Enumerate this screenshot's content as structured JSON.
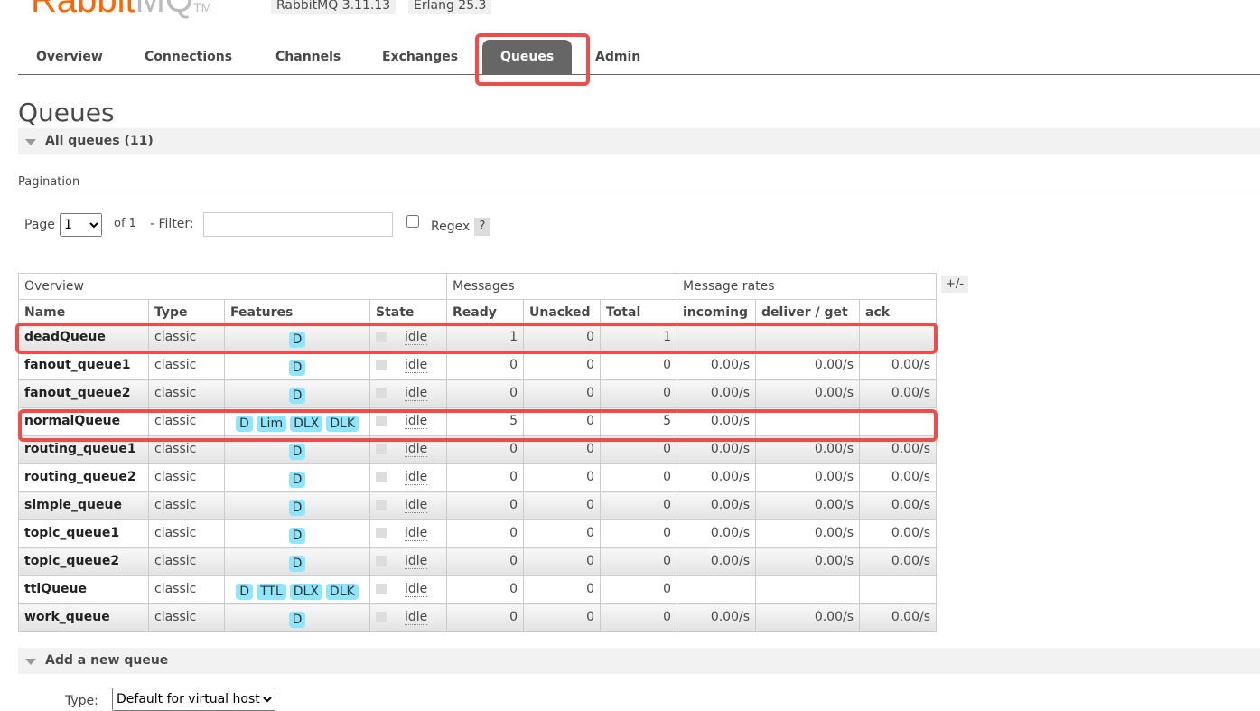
{
  "header": {
    "logo": "RabbitMQ",
    "versions": [
      "RabbitMQ 3.11.13",
      "Erlang 25.3"
    ]
  },
  "nav": [
    "Overview",
    "Connections",
    "Channels",
    "Exchanges",
    "Queues",
    "Admin"
  ],
  "active_tab": "Queues",
  "page_title": "Queues",
  "all_queues": "All queues (11)",
  "pagination": {
    "label": "Pagination",
    "page_label": "Page",
    "page_value": "1",
    "of": "of 1",
    "filter_label": "- Filter:",
    "filter_value": "",
    "regex_label": "Regex",
    "help": "?"
  },
  "table": {
    "groups": [
      "Overview",
      "Messages",
      "Message rates"
    ],
    "columns": [
      "Name",
      "Type",
      "Features",
      "State",
      "Ready",
      "Unacked",
      "Total",
      "incoming",
      "deliver / get",
      "ack"
    ],
    "plus_minus": "+/-",
    "rows": [
      {
        "name": "deadQueue",
        "type": "classic",
        "features": [
          "D"
        ],
        "state": "idle",
        "ready": "1",
        "unacked": "0",
        "total": "1",
        "incoming": "",
        "deliver": "",
        "ack": ""
      },
      {
        "name": "fanout_queue1",
        "type": "classic",
        "features": [
          "D"
        ],
        "state": "idle",
        "ready": "0",
        "unacked": "0",
        "total": "0",
        "incoming": "0.00/s",
        "deliver": "0.00/s",
        "ack": "0.00/s"
      },
      {
        "name": "fanout_queue2",
        "type": "classic",
        "features": [
          "D"
        ],
        "state": "idle",
        "ready": "0",
        "unacked": "0",
        "total": "0",
        "incoming": "0.00/s",
        "deliver": "0.00/s",
        "ack": "0.00/s"
      },
      {
        "name": "normalQueue",
        "type": "classic",
        "features": [
          "D",
          "Lim",
          "DLX",
          "DLK"
        ],
        "state": "idle",
        "ready": "5",
        "unacked": "0",
        "total": "5",
        "incoming": "0.00/s",
        "deliver": "",
        "ack": ""
      },
      {
        "name": "routing_queue1",
        "type": "classic",
        "features": [
          "D"
        ],
        "state": "idle",
        "ready": "0",
        "unacked": "0",
        "total": "0",
        "incoming": "0.00/s",
        "deliver": "0.00/s",
        "ack": "0.00/s"
      },
      {
        "name": "routing_queue2",
        "type": "classic",
        "features": [
          "D"
        ],
        "state": "idle",
        "ready": "0",
        "unacked": "0",
        "total": "0",
        "incoming": "0.00/s",
        "deliver": "0.00/s",
        "ack": "0.00/s"
      },
      {
        "name": "simple_queue",
        "type": "classic",
        "features": [
          "D"
        ],
        "state": "idle",
        "ready": "0",
        "unacked": "0",
        "total": "0",
        "incoming": "0.00/s",
        "deliver": "0.00/s",
        "ack": "0.00/s"
      },
      {
        "name": "topic_queue1",
        "type": "classic",
        "features": [
          "D"
        ],
        "state": "idle",
        "ready": "0",
        "unacked": "0",
        "total": "0",
        "incoming": "0.00/s",
        "deliver": "0.00/s",
        "ack": "0.00/s"
      },
      {
        "name": "topic_queue2",
        "type": "classic",
        "features": [
          "D"
        ],
        "state": "idle",
        "ready": "0",
        "unacked": "0",
        "total": "0",
        "incoming": "0.00/s",
        "deliver": "0.00/s",
        "ack": "0.00/s"
      },
      {
        "name": "ttlQueue",
        "type": "classic",
        "features": [
          "D",
          "TTL",
          "DLX",
          "DLK"
        ],
        "state": "idle",
        "ready": "0",
        "unacked": "0",
        "total": "0",
        "incoming": "",
        "deliver": "",
        "ack": ""
      },
      {
        "name": "work_queue",
        "type": "classic",
        "features": [
          "D"
        ],
        "state": "idle",
        "ready": "0",
        "unacked": "0",
        "total": "0",
        "incoming": "0.00/s",
        "deliver": "0.00/s",
        "ack": "0.00/s"
      }
    ]
  },
  "add_queue": {
    "title": "Add a new queue",
    "type_label": "Type:",
    "type_value": "Default for virtual host"
  },
  "colors": {
    "accent": "#ff6600",
    "badge": "#8ee5fc",
    "annotation": "#f44a4a",
    "active_tab": "#666666"
  }
}
